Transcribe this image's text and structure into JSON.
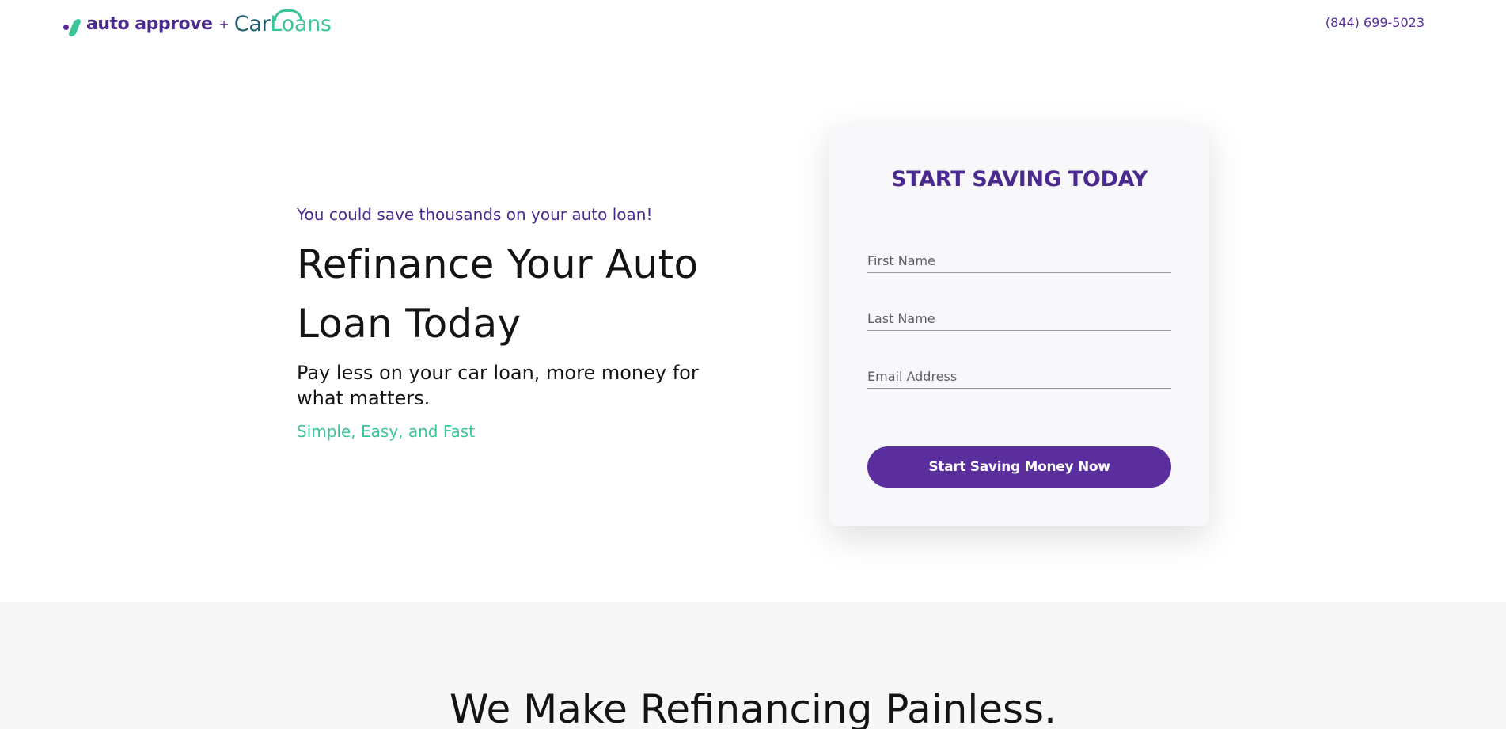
{
  "header": {
    "logo": {
      "brand_primary": "auto approve",
      "plus": "+",
      "brand_secondary_car": "Car",
      "brand_secondary_loans": "Loans"
    },
    "phone": "(844) 699-5023"
  },
  "hero": {
    "tagline": "You could save thousands on your auto loan!",
    "headline_line1": "Refinance Your Auto",
    "headline_line2": "Loan Today",
    "subhead": "Pay less on your car loan, more money for what matters.",
    "features": "Simple, Easy, and Fast"
  },
  "form": {
    "title": "START SAVING TODAY",
    "first_name": {
      "placeholder": "First Name",
      "value": ""
    },
    "last_name": {
      "placeholder": "Last Name",
      "value": ""
    },
    "email": {
      "placeholder": "Email Address",
      "value": ""
    },
    "submit_label": "Start Saving Money Now"
  },
  "section_two": {
    "title": "We Make Refinancing Painless."
  },
  "colors": {
    "brand_purple": "#5b2e9e",
    "brand_green": "#3cc49a",
    "brand_teal": "#1f5d6a",
    "card_background": "#f8f7fa",
    "section_background": "#f7f7f8"
  }
}
